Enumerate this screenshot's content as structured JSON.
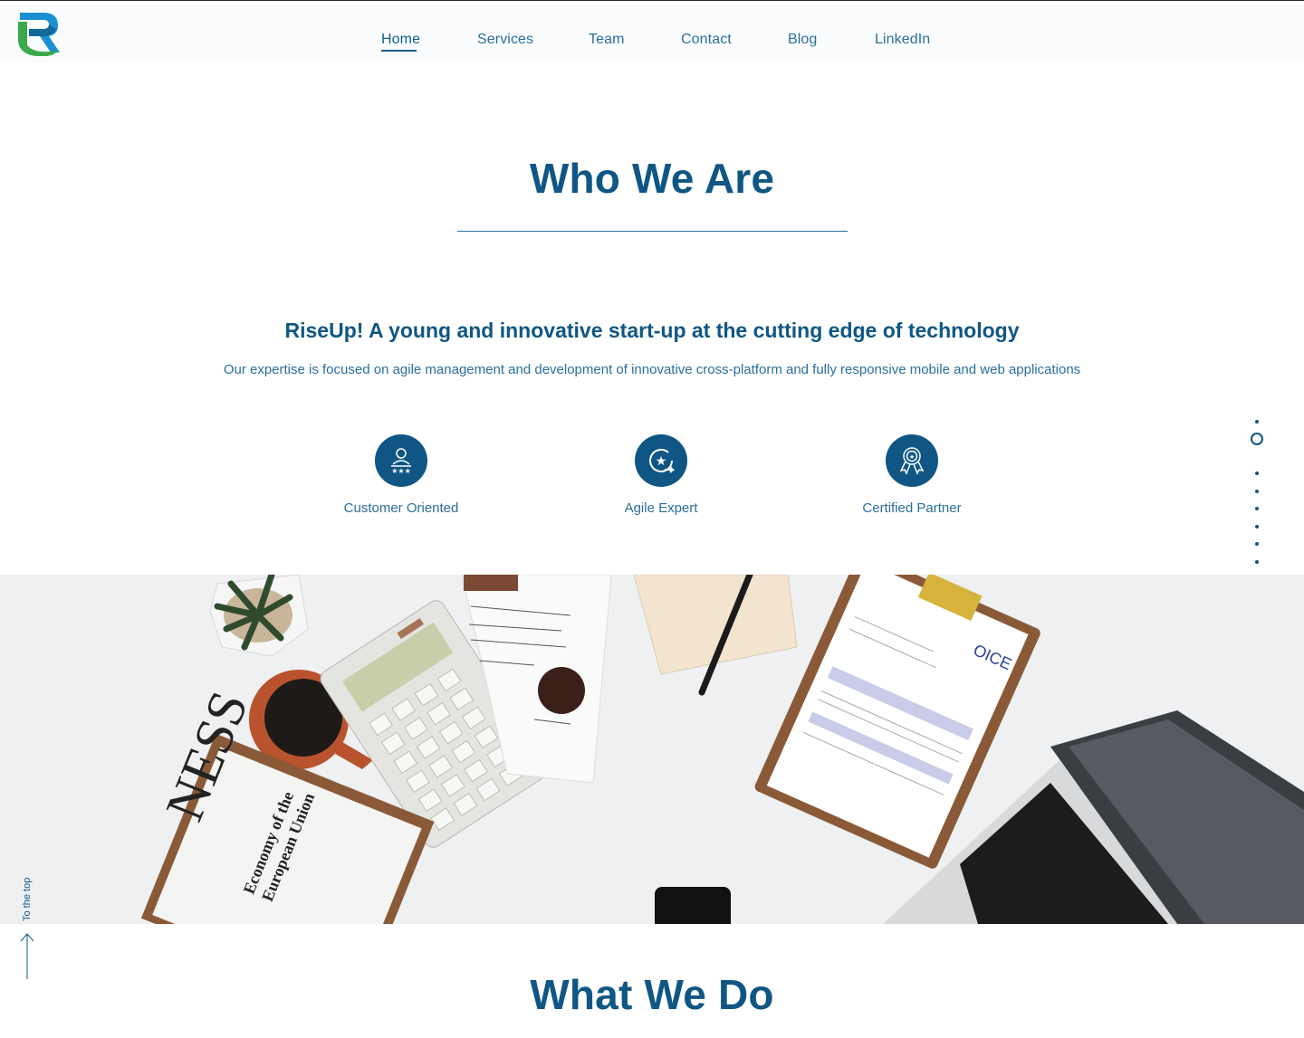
{
  "header": {
    "logo_alt": "RiseUp logo",
    "nav": [
      {
        "label": "Home",
        "active": true
      },
      {
        "label": "Services",
        "active": false
      },
      {
        "label": "Team",
        "active": false
      },
      {
        "label": "Contact",
        "active": false
      },
      {
        "label": "Blog",
        "active": false
      },
      {
        "label": "LinkedIn",
        "active": false
      }
    ]
  },
  "who_we_are": {
    "title": "Who We Are",
    "tagline": "RiseUp! A young and innovative start-up at the cutting edge of technology",
    "description": "Our expertise is focused on agile management and development of innovative cross-platform and fully responsive mobile and web applications",
    "features": [
      {
        "icon": "customer-icon",
        "label": "Customer Oriented"
      },
      {
        "icon": "agile-icon",
        "label": "Agile Expert"
      },
      {
        "icon": "certified-icon",
        "label": "Certified Partner"
      }
    ]
  },
  "section_nav": {
    "count": 9,
    "active_index": 1
  },
  "what_we_do": {
    "title": "What We Do"
  },
  "to_top": {
    "label": "To the top"
  },
  "colors": {
    "brand": "#0f5684",
    "accent_text": "#2a6f9c",
    "logo_green": "#3aa94a",
    "logo_blue": "#1a8fd0"
  }
}
